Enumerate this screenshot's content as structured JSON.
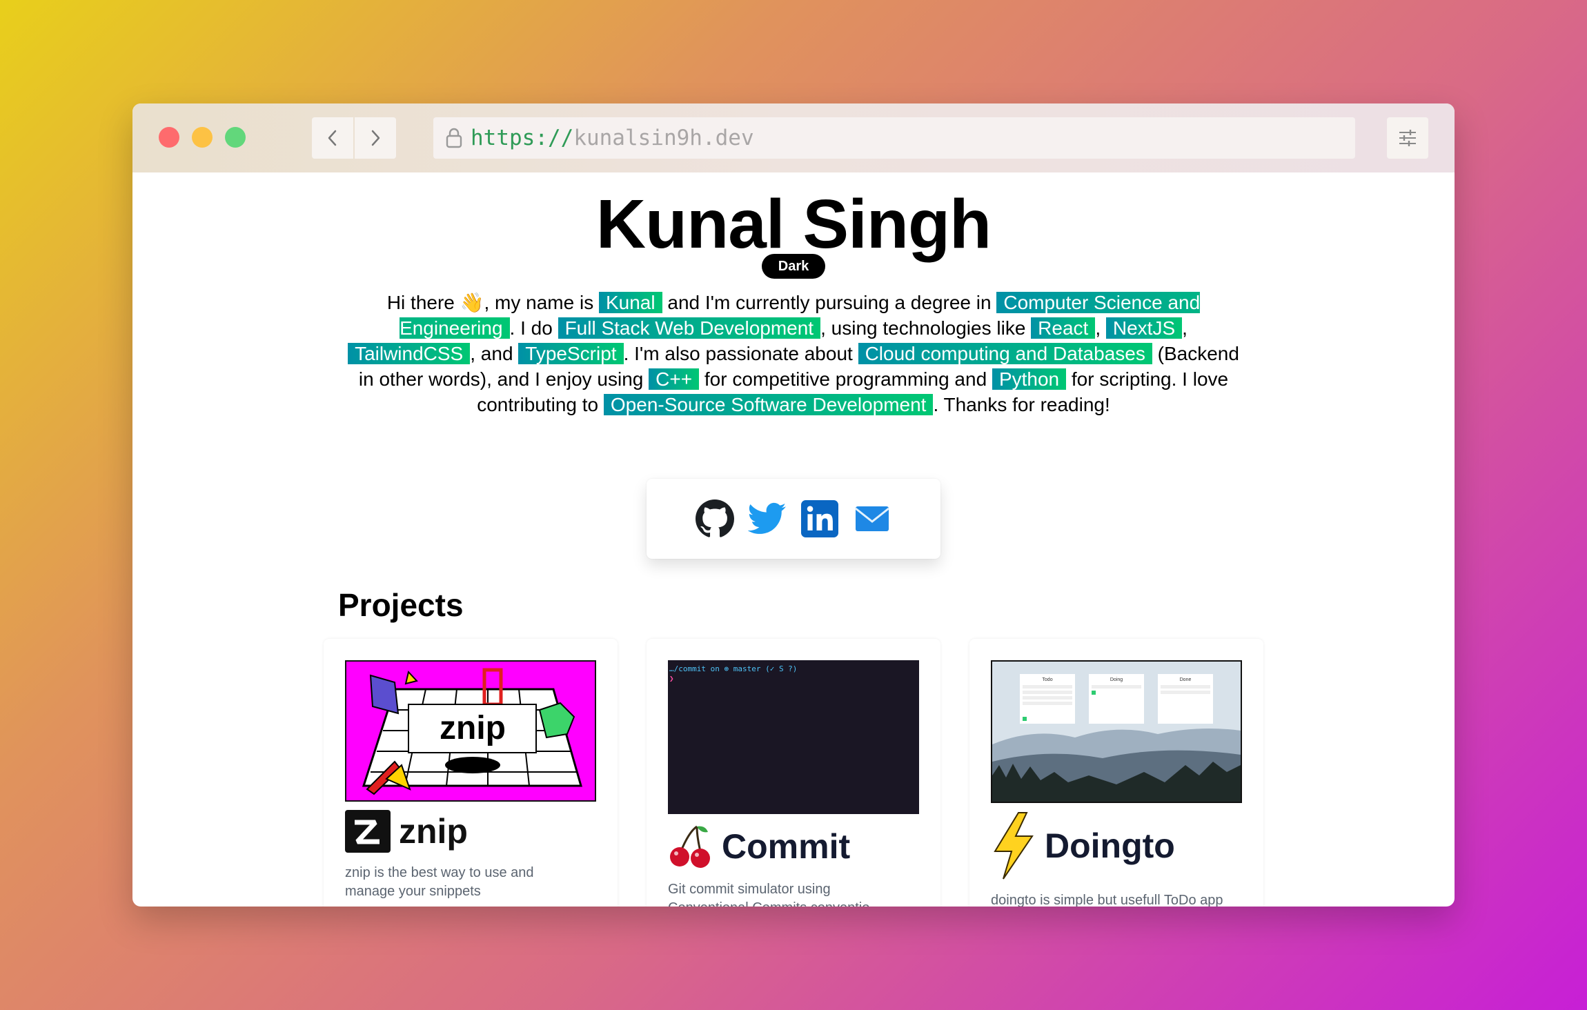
{
  "browser": {
    "url_protocol": "https://",
    "url_host": "kunalsin9h.dev"
  },
  "hero": {
    "name": "Kunal Singh",
    "theme_toggle": "Dark"
  },
  "bio": {
    "t1": "Hi there 👋, my name is ",
    "h1": "Kunal",
    "t2": " and I'm currently pursuing a degree in ",
    "h2": "Computer Science and Engineering",
    "t3": ". I do ",
    "h3": "Full Stack Web Development",
    "t4": ", using technologies like ",
    "h4": "React",
    "t5": ", ",
    "h5": "NextJS",
    "t6": ", ",
    "h6": "TailwindCSS",
    "t7": ", and ",
    "h7": "TypeScript",
    "t8": ". I'm also passionate about ",
    "h8": "Cloud computing and Databases",
    "t9": " (Backend in other words), and I enjoy using ",
    "h9": "C++",
    "t10": " for competitive programming and ",
    "h10": "Python",
    "t11": " for scripting. I love contributing to ",
    "h11": "Open-Source Software Development",
    "t12": ". Thanks for reading!"
  },
  "socials": [
    "github-icon",
    "twitter-icon",
    "linkedin-icon",
    "mail-icon"
  ],
  "projects": {
    "heading": "Projects",
    "items": [
      {
        "title": "znip",
        "thumb_text": "znip",
        "description": "znip is the best way to use and manage your snippets"
      },
      {
        "title": "Commit",
        "thumb_line1": "…/commit on ⊕ master (✓ S ?)",
        "thumb_line2": "❯",
        "description": "Git commit simulator using Conventional Commits conventio"
      },
      {
        "title": "Doingto",
        "description": "doingto is simple but usefull ToDo app",
        "thumb_cols": [
          "Todo",
          "Doing",
          "Done"
        ]
      }
    ]
  },
  "colors": {
    "highlight_start": "#0091a6",
    "highlight_end": "#00c773",
    "znip_bg": "#ff00ff",
    "commit_bg": "#1a1624"
  }
}
